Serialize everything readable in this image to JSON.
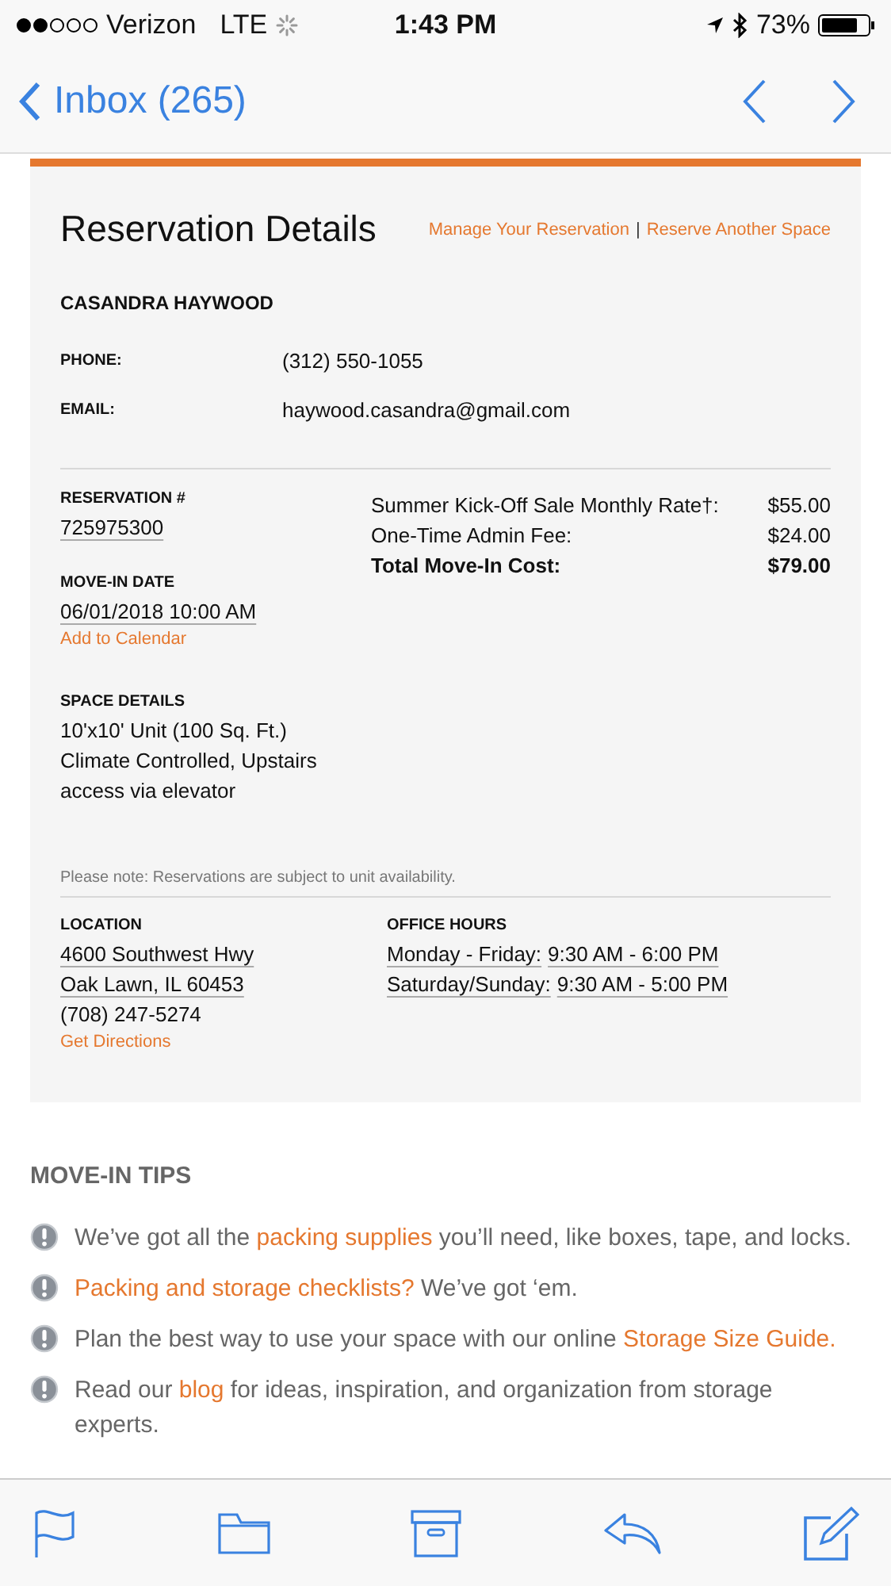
{
  "status_bar": {
    "carrier": "Verizon",
    "network": "LTE",
    "time": "1:43 PM",
    "battery": "73%"
  },
  "nav": {
    "back": "Inbox (265)"
  },
  "reservation": {
    "title": "Reservation Details",
    "links": [
      "Manage Your Reservation",
      "Reserve Another Space"
    ],
    "separator": "|",
    "name": "CASANDRA HAYWOOD",
    "contact": [
      {
        "label": "PHONE:",
        "value": "(312) 550-1055"
      },
      {
        "label": "EMAIL:",
        "value": "haywood.casandra@gmail.com"
      }
    ],
    "number_label": "RESERVATION #",
    "number": "725975300",
    "date_label": "MOVE-IN DATE",
    "date": "06/01/2018 10:00 AM",
    "calendar_link": "Add to Calendar",
    "space_label": "SPACE DETAILS",
    "space_lines": [
      "10'x10' Unit (100 Sq. Ft.)",
      "Climate Controlled, Upstairs",
      "access via elevator"
    ],
    "costs": [
      {
        "label": "Summer Kick-Off Sale Monthly Rate†:",
        "amount": "$55.00",
        "total": false
      },
      {
        "label": "One-Time Admin Fee:",
        "amount": "$24.00",
        "total": false
      },
      {
        "label": "Total Move-In Cost:",
        "amount": "$79.00",
        "total": true
      }
    ],
    "note": "Please note: Reservations are subject to unit availability.",
    "location_label": "LOCATION",
    "address": [
      "4600 Southwest Hwy",
      "Oak Lawn, IL 60453"
    ],
    "phone": "(708) 247-5274",
    "directions_link": "Get Directions",
    "hours_label": "OFFICE HOURS",
    "hours": [
      {
        "days": "Monday - Friday:",
        "time": "9:30 AM - 6:00 PM"
      },
      {
        "days": "Saturday/Sunday:",
        "time": "9:30 AM - 5:00 PM"
      }
    ]
  },
  "tips": {
    "title": "MOVE-IN TIPS",
    "items": [
      [
        {
          "text": "We’ve got all the ",
          "link": false
        },
        {
          "text": "packing supplies",
          "link": true
        },
        {
          "text": " you’ll need, like boxes, tape, and locks.",
          "link": false
        }
      ],
      [
        {
          "text": "Packing and storage checklists?",
          "link": true
        },
        {
          "text": " We’ve got ‘em.",
          "link": false
        }
      ],
      [
        {
          "text": "Plan the best way to use your space with our online ",
          "link": false
        },
        {
          "text": "Storage Size Guide.",
          "link": true
        }
      ],
      [
        {
          "text": "Read our ",
          "link": false
        },
        {
          "text": "blog",
          "link": true
        },
        {
          "text": " for ideas, inspiration, and organization from storage experts.",
          "link": false
        }
      ]
    ]
  }
}
